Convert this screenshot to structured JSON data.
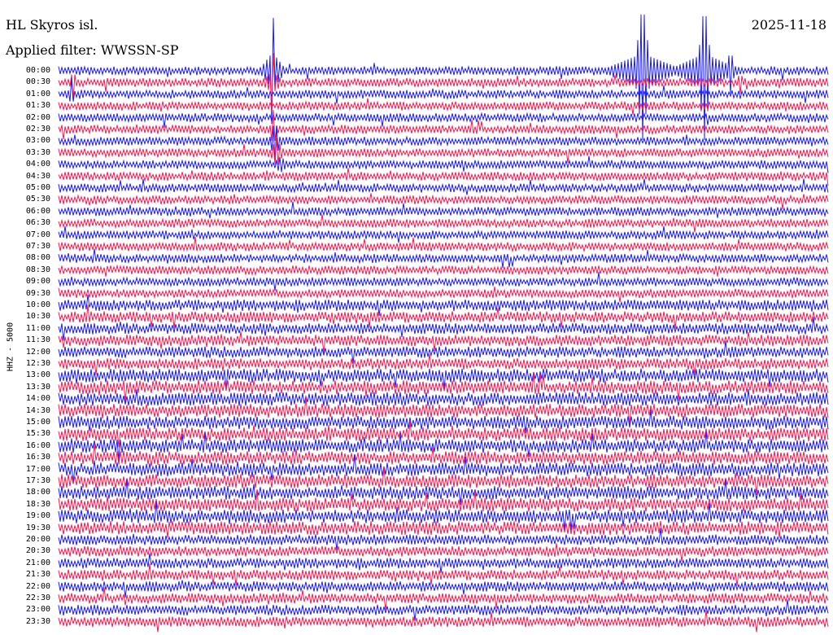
{
  "header": {
    "station": "HL Skyros isl.",
    "filter": "Applied filter: WWSSN-SP",
    "date": "2025-11-18"
  },
  "chart_data": {
    "type": "line",
    "title": "HL Skyros isl.",
    "subtitle": "Applied filter: WWSSN-SP",
    "date": "2025-11-18",
    "ylabel": "HHZ - 5000",
    "rows": [
      "00:00",
      "00:30",
      "01:00",
      "01:30",
      "02:00",
      "02:30",
      "03:00",
      "03:30",
      "04:00",
      "04:30",
      "05:00",
      "05:30",
      "06:00",
      "06:30",
      "07:00",
      "07:30",
      "08:00",
      "08:30",
      "09:00",
      "09:30",
      "10:00",
      "10:30",
      "11:00",
      "11:30",
      "12:00",
      "12:30",
      "13:00",
      "13:30",
      "14:00",
      "14:30",
      "15:00",
      "15:30",
      "16:00",
      "16:30",
      "17:00",
      "17:30",
      "18:00",
      "18:30",
      "19:00",
      "19:30",
      "20:00",
      "20:30",
      "21:00",
      "21:30",
      "22:00",
      "22:30",
      "23:00",
      "23:30"
    ],
    "series_colors": [
      "#1b1bf5",
      "#f5194f"
    ],
    "color_order": "alternating",
    "row_duration_minutes": 30,
    "grid": false
  }
}
